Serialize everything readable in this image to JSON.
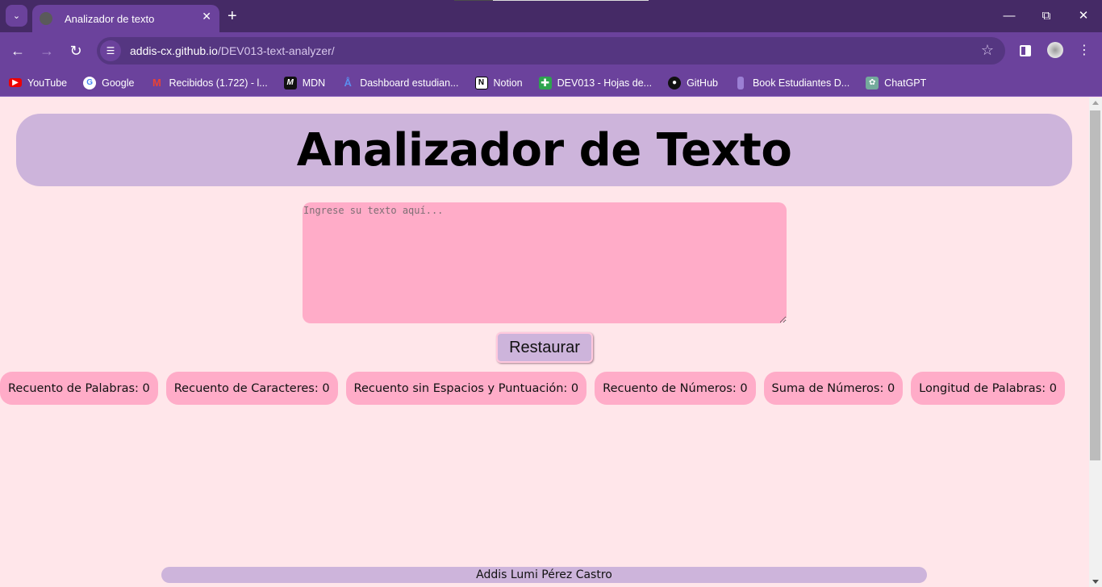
{
  "browser": {
    "tab_title": "Analizador de texto",
    "url_host": "addis-cx.github.io",
    "url_path": "/DEV013-text-analyzer/",
    "bookmarks": [
      {
        "label": "YouTube",
        "icon": "youtube-icon"
      },
      {
        "label": "Google",
        "icon": "google-icon"
      },
      {
        "label": "Recibidos (1.722) - l...",
        "icon": "gmail-icon"
      },
      {
        "label": "MDN",
        "icon": "mdn-icon"
      },
      {
        "label": "Dashboard estudian...",
        "icon": "dashboard-icon"
      },
      {
        "label": "Notion",
        "icon": "notion-icon"
      },
      {
        "label": "DEV013 - Hojas de...",
        "icon": "sheets-icon"
      },
      {
        "label": "GitHub",
        "icon": "github-icon"
      },
      {
        "label": "Book Estudiantes D...",
        "icon": "book-icon"
      },
      {
        "label": "ChatGPT",
        "icon": "chatgpt-icon"
      }
    ]
  },
  "page": {
    "title": "Analizador de Texto",
    "textarea": {
      "value": "",
      "placeholder": "Ingrese su texto aquí..."
    },
    "reset_label": "Restaurar",
    "stats": [
      {
        "label": "Recuento de Palabras: 0"
      },
      {
        "label": "Recuento de Caracteres: 0"
      },
      {
        "label": "Recuento sin Espacios y Puntuación: 0"
      },
      {
        "label": "Recuento de Números: 0"
      },
      {
        "label": "Suma de Números: 0"
      },
      {
        "label": "Longitud de Palabras: 0"
      }
    ],
    "footer": "Addis Lumi Pérez Castro"
  },
  "colors": {
    "background": "#ffe6ea",
    "header": "#cdb4db",
    "textarea": "#ffacc8",
    "stat": "#ffacc8",
    "chrome": "#6b429c"
  }
}
